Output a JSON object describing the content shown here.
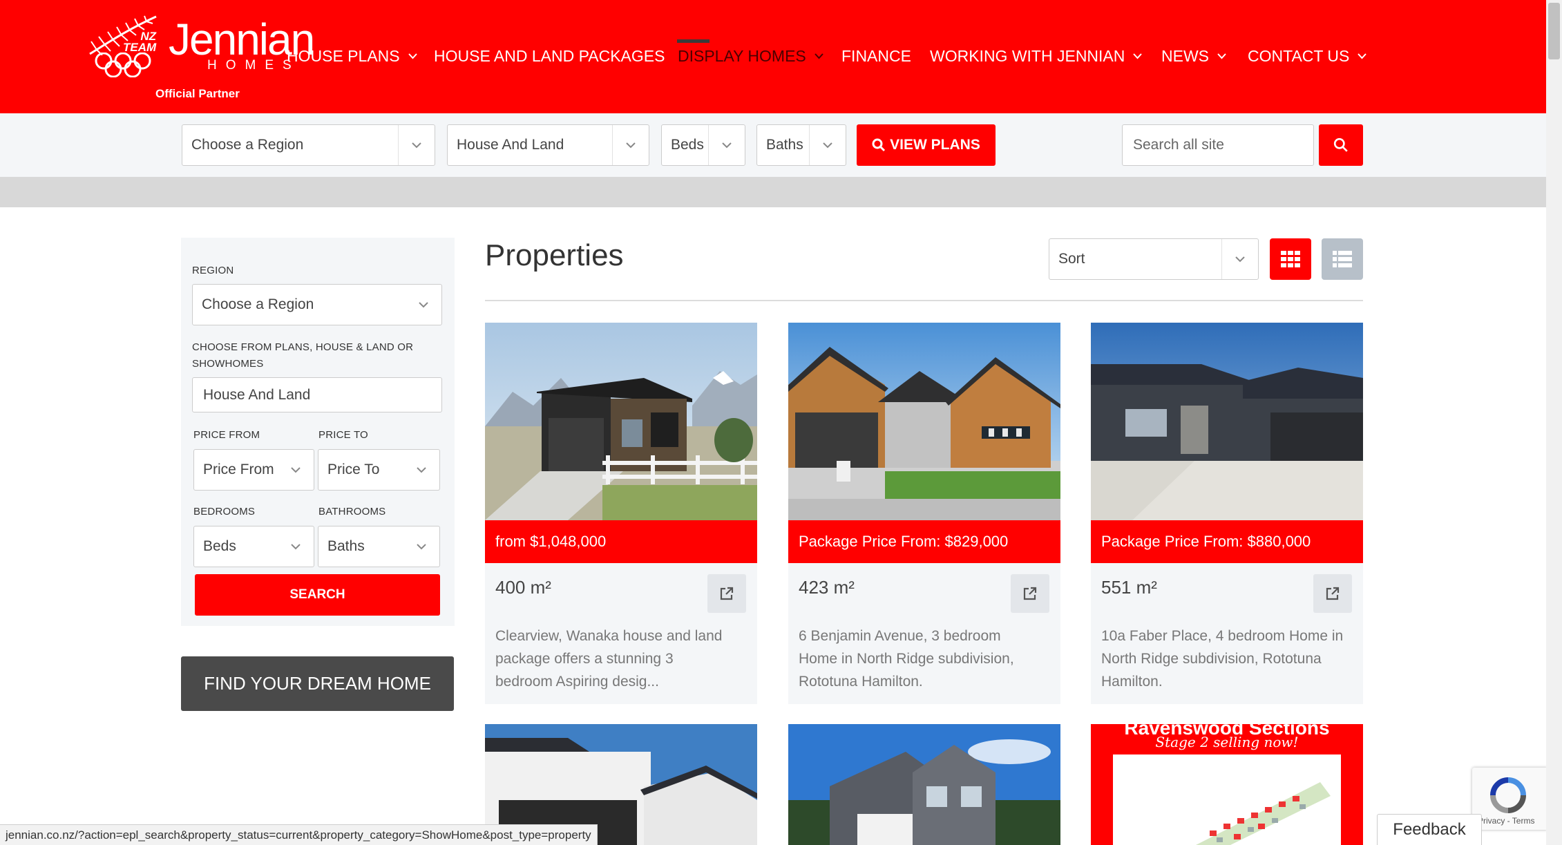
{
  "brand": {
    "team_line1": "NZ",
    "team_line2": "TEAM",
    "name": "Jennian",
    "sub": "HOMES",
    "partner": "Official Partner"
  },
  "nav": {
    "items": [
      {
        "label": "HOUSE PLANS",
        "dropdown": true
      },
      {
        "label": "HOUSE AND LAND PACKAGES",
        "dropdown": false
      },
      {
        "label": "DISPLAY HOMES",
        "dropdown": true,
        "active": true
      },
      {
        "label": "FINANCE",
        "dropdown": false
      },
      {
        "label": "WORKING WITH JENNIAN",
        "dropdown": true
      },
      {
        "label": "NEWS",
        "dropdown": true
      },
      {
        "label": "CONTACT US",
        "dropdown": true
      }
    ]
  },
  "searchbar": {
    "region": "Choose a Region",
    "category": "House And Land",
    "beds": "Beds",
    "baths": "Baths",
    "view_plans": "VIEW PLANS",
    "site_search_placeholder": "Search all site"
  },
  "sidebar": {
    "region_label": "REGION",
    "region_value": "Choose a Region",
    "category_label_1": "CHOOSE FROM PLANS, HOUSE & LAND OR",
    "category_label_2": "SHOWHOMES",
    "category_value": "House And Land",
    "price_from_label": "PRICE FROM",
    "price_to_label": "PRICE TO",
    "price_from_value": "Price From",
    "price_to_value": "Price To",
    "bedrooms_label": "BEDROOMS",
    "bathrooms_label": "BATHROOMS",
    "beds_value": "Beds",
    "baths_value": "Baths",
    "search_button": "SEARCH",
    "find_button": "FIND YOUR DREAM HOME"
  },
  "main": {
    "title": "Properties",
    "sort": "Sort"
  },
  "properties": [
    {
      "price": "from $1,048,000",
      "area": "400 m²",
      "desc": [
        "Clearview, Wanaka house and land",
        "package offers a stunning 3",
        "bedroom Aspiring desig..."
      ]
    },
    {
      "price": "Package Price From: $829,000",
      "area": "423 m²",
      "desc": [
        "6 Benjamin Avenue, 3 bedroom",
        "Home in North Ridge subdivision,",
        "Rototuna Hamilton."
      ]
    },
    {
      "price": "Package Price From: $880,000",
      "area": "551 m²",
      "desc": [
        "10a Faber Place, 4 bedroom Home in",
        "North Ridge subdivision, Rototuna",
        "Hamilton."
      ]
    }
  ],
  "promo": {
    "title": "Ravenswood Sections",
    "subtitle": "Stage 2 selling now!"
  },
  "status_url": "jennian.co.nz/?action=epl_search&property_status=current&property_category=ShowHome&post_type=property",
  "recaptcha_text": "Privacy - Terms",
  "feedback": "Feedback",
  "colors": {
    "brand_red": "#ff0000",
    "dark_grey": "#4a4a4a",
    "panel": "#f4f6f8"
  }
}
